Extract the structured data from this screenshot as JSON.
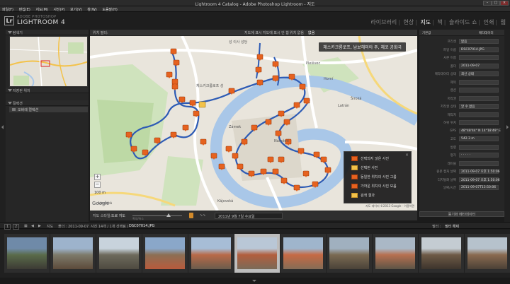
{
  "window": {
    "title": "Lightroom 4 Catalog - Adobe Photoshop Lightroom - 지도"
  },
  "menu": [
    "파일(F)",
    "편집(E)",
    "지도(M)",
    "사진(P)",
    "보기(V)",
    "창(W)",
    "도움말(H)"
  ],
  "app": {
    "logo_letters": "Lr",
    "brand_small": "ADOBE PHOTOSHOP",
    "brand_name": "LIGHTROOM 4"
  },
  "modules": [
    {
      "label": "라이브러리",
      "active": false
    },
    {
      "label": "현상",
      "active": false
    },
    {
      "label": "지도",
      "active": true
    },
    {
      "label": "책",
      "active": false
    },
    {
      "label": "슬라이드 쇼",
      "active": false
    },
    {
      "label": "인쇄",
      "active": false
    },
    {
      "label": "웹",
      "active": false
    }
  ],
  "left_panel": {
    "navigator_label": "탐색기",
    "saved_locations_label": "저장된 위치",
    "collections_label": "컬렉션",
    "collection_item": "오버레 컬렉션"
  },
  "map_bar": {
    "filter_label": "위치 필터:",
    "options": [
      "지도에 표시",
      "지도에 표시 안 함",
      "위치 없음",
      "없음"
    ]
  },
  "map": {
    "banner": "체스키크룸로프, 남보헤미아 주, 체코 공화국",
    "place_labels": [
      "성 이사 성당",
      "체스키크룸로프 성",
      "Latrán",
      "Horní",
      "Široká",
      "Náměstí",
      "Kájovská",
      "Rybářská",
      "Linecká",
      "Plešivec",
      "Pivovarská",
      "Zámek"
    ],
    "legend": [
      {
        "label": "선택되지 않은 사진",
        "color": "#e6621f"
      },
      {
        "label": "선택된 사진",
        "color": "#f3c24a"
      },
      {
        "label": "동일한 위치의 사진 그룹",
        "color": "#e6621f"
      },
      {
        "label": "가까운 위치의 사진 모음",
        "color": "#e6621f"
      },
      {
        "label": "검색 결과",
        "color": "#f3c24a"
      }
    ],
    "scale": "100 m",
    "google": "Google",
    "copyright": "지도 데이터 ©2013 Google · 이용약관"
  },
  "toolbar": {
    "style_label": "지도 스타일:",
    "style_value": "도로 지도",
    "zoom_label": "확대/축소",
    "date_value": "2011년 9월 7일 수요일"
  },
  "right_panel": {
    "header_left": "기본값",
    "header_right": "메타데이터",
    "rows": [
      {
        "label": "프리셋",
        "value": "없음"
      },
      {
        "label": "파일 이름",
        "value": "DSC07014.JPG"
      },
      {
        "label": "사본 이름",
        "value": ""
      },
      {
        "label": "폴더",
        "value": "2011-09-07"
      },
      {
        "label": "메타데이터 상태",
        "value": "최신 상태"
      },
      {
        "label": "제목",
        "value": ""
      },
      {
        "label": "캡션",
        "value": ""
      },
      {
        "label": "저작권",
        "value": ""
      },
      {
        "label": "저작권 상태",
        "value": "알 수 없음"
      },
      {
        "label": "제작자",
        "value": ""
      },
      {
        "label": "하위 위치",
        "value": ""
      },
      {
        "label": "GPS",
        "value": "48°48'44\" N 14°18'49\" E"
      },
      {
        "label": "고도",
        "value": "542.3 m"
      },
      {
        "label": "방향",
        "value": ""
      },
      {
        "label": "평가",
        "value": "· · · · ·"
      },
      {
        "label": "레이블",
        "value": ""
      },
      {
        "label": "원본 캡처 날짜",
        "value": "2011-09-07 오후 1:50:06"
      },
      {
        "label": "디지털화 날짜",
        "value": "2011-09-07 오후 1:50:06"
      },
      {
        "label": "날짜/시간",
        "value": "2011-09-07T13:50:06"
      }
    ],
    "footer": "동기화 메타데이터"
  },
  "filmstrip_bar": {
    "left_icons": [
      "1",
      "2"
    ],
    "source": "지도",
    "info": "폴더 : 2011-09-07",
    "count": "사진 14개 / 1개 선택됨 /",
    "file": "DSC07014.JPG",
    "filter_label": "필터 :",
    "filter_value": "필터 해제"
  },
  "filmstrip": {
    "selected_index": 5
  }
}
